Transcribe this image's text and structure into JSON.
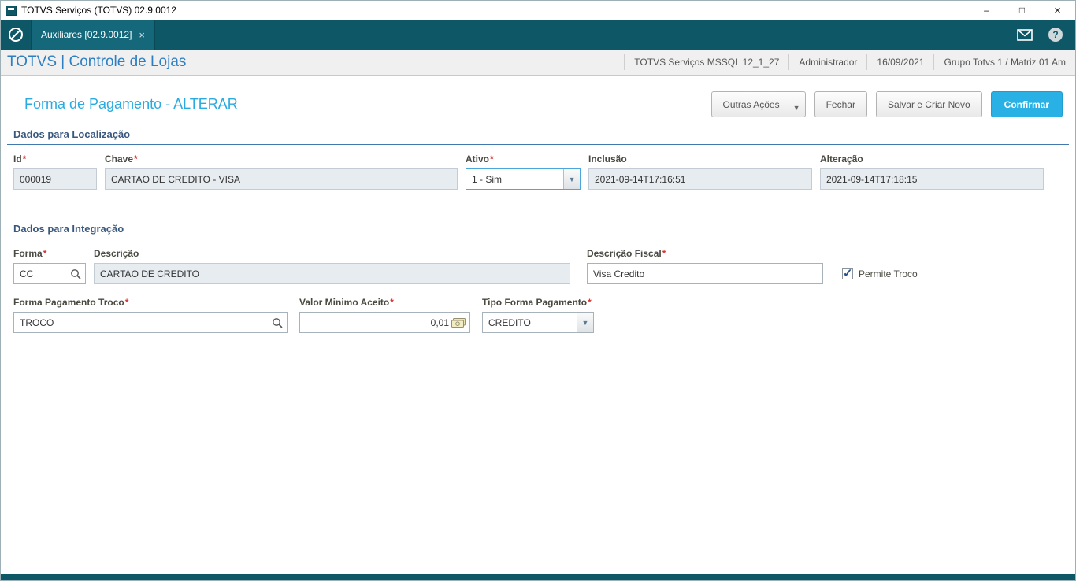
{
  "window": {
    "title": "TOTVS Serviços (TOTVS) 02.9.0012",
    "minimize": "–",
    "maximize": "□",
    "close": "×"
  },
  "tabbar": {
    "tab_label": "Auxiliares [02.9.0012]",
    "tab_close": "×",
    "help": "?"
  },
  "header": {
    "brand": "TOTVS | Controle de Lojas",
    "environment": "TOTVS Serviços MSSQL 12_1_27",
    "user": "Administrador",
    "date": "16/09/2021",
    "group": "Grupo Totvs 1 / Matriz 01 Am"
  },
  "page": {
    "title": "Forma de Pagamento - ALTERAR"
  },
  "actions": {
    "outras_acoes": "Outras Ações",
    "caret": "▼",
    "fechar": "Fechar",
    "salvar_criar_novo": "Salvar e Criar Novo",
    "confirmar": "Confirmar"
  },
  "required_marker": "*",
  "sections": {
    "localizacao": {
      "title": "Dados para Localização",
      "id_label": "Id",
      "id_value": "000019",
      "chave_label": "Chave",
      "chave_value": "CARTAO DE CREDITO - VISA",
      "ativo_label": "Ativo",
      "ativo_value": "1 - Sim",
      "inclusao_label": "Inclusão",
      "inclusao_value": "2021-09-14T17:16:51",
      "alteracao_label": "Alteração",
      "alteracao_value": "2021-09-14T17:18:15"
    },
    "integracao": {
      "title": "Dados para Integração",
      "forma_label": "Forma",
      "forma_value": "CC",
      "descricao_label": "Descrição",
      "descricao_value": "CARTAO DE CREDITO",
      "descricao_fiscal_label": "Descrição Fiscal",
      "descricao_fiscal_value": "Visa Credito",
      "permite_troco_label": "Permite Troco",
      "forma_troco_label": "Forma Pagamento Troco",
      "forma_troco_value": "TROCO",
      "valor_minimo_label": "Valor Minimo Aceito",
      "valor_minimo_value": "0,01",
      "tipo_label": "Tipo Forma Pagamento",
      "tipo_value": "CREDITO"
    }
  },
  "colors": {
    "teal": "#0d5766",
    "accent": "#29abe2",
    "section_line": "#4178ae",
    "required": "#d83535",
    "confirm_button": "#29b0e4"
  }
}
